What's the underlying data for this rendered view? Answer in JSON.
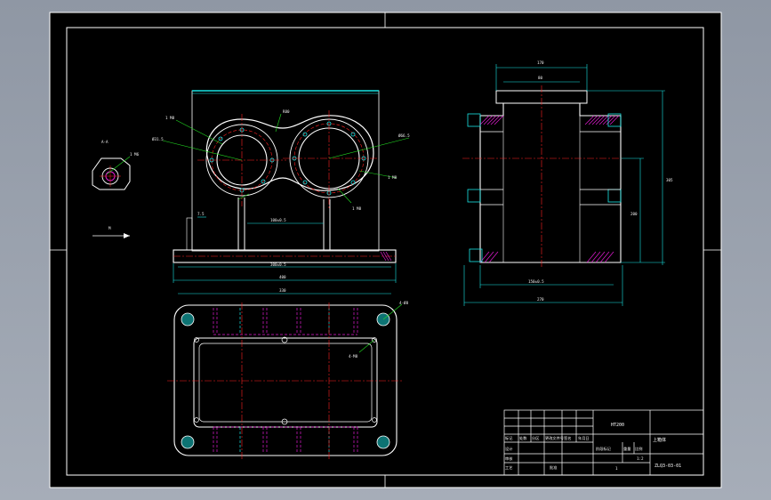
{
  "drawing": {
    "background": "#000000",
    "outline_color": "#ffffff",
    "dim_color": "#19e6e6",
    "leader_color": "#22dd22",
    "center_color": "#ff2222",
    "hidden_color": "#e01bd0"
  },
  "front_view": {
    "callouts": [
      "1 M8",
      "Ø31.5",
      "R80",
      "Ø66.5",
      "1 M8",
      "1 M8"
    ],
    "dims": [
      "7.5",
      "100±0.5",
      "300±0.5",
      "400"
    ]
  },
  "detail": {
    "label": "A-A",
    "callout": "1 M6"
  },
  "side_view": {
    "dims": [
      "170",
      "80",
      "305",
      "200",
      "150±0.5",
      "270"
    ]
  },
  "top_view": {
    "dims": [
      "330"
    ],
    "callouts": [
      "4-Ø8",
      "4-M8"
    ]
  },
  "arrow_label": "M",
  "title_block": {
    "material": "HT200",
    "name": "上箱体",
    "drawing_no": "ZLQ3-03-01",
    "scale": "1:2",
    "sheet": "1",
    "header_labels": [
      "标记",
      "处数",
      "分区",
      "更改文件号",
      "签名",
      "年月日"
    ],
    "row_labels": [
      "设计",
      "审核",
      "工艺",
      "批准"
    ],
    "stage_label": "阶段标记",
    "weight_label": "重量",
    "scale_label": "比例"
  }
}
